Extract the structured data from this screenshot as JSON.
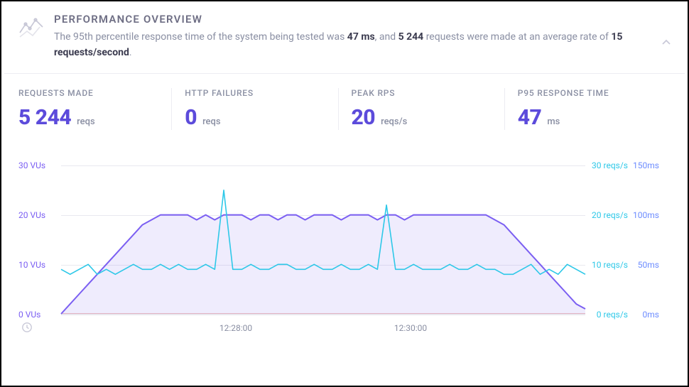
{
  "header": {
    "title": "PERFORMANCE OVERVIEW",
    "subtitle_pre": "The 95th percentile response time of the system being tested was ",
    "p95_ms": "47 ms",
    "subtitle_mid1": ", and ",
    "total_requests": "5 244",
    "subtitle_mid2": " requests were made at an average rate of ",
    "avg_rate": "15 requests/second",
    "subtitle_post": "."
  },
  "stats": [
    {
      "label": "REQUESTS MADE",
      "value": "5 244",
      "unit": "reqs"
    },
    {
      "label": "HTTP FAILURES",
      "value": "0",
      "unit": "reqs"
    },
    {
      "label": "PEAK RPS",
      "value": "20",
      "unit": "reqs/s"
    },
    {
      "label": "P95 RESPONSE TIME",
      "value": "47",
      "unit": "ms"
    }
  ],
  "chart_data": {
    "type": "line",
    "x_ticks": [
      "12:28:00",
      "12:30:00"
    ],
    "left_axis": {
      "label": "VUs",
      "ticks": [
        0,
        10,
        20,
        30
      ],
      "range": [
        0,
        30
      ],
      "color": "#7b5ff2"
    },
    "right_axis": {
      "label": "reqs/s",
      "ticks": [
        0,
        10,
        20,
        30
      ],
      "range": [
        0,
        30
      ],
      "color": "#2dc8e8"
    },
    "right_axis2": {
      "label": "ms",
      "ticks": [
        0,
        50,
        100,
        150
      ],
      "range": [
        0,
        150
      ],
      "color": "#6c8cff"
    },
    "series": [
      {
        "name": "VUs",
        "axis": "left",
        "color": "#7b5ff2",
        "fill": "rgba(123,95,242,0.12)",
        "values": [
          0,
          2,
          4,
          6,
          8,
          10,
          12,
          14,
          16,
          18,
          19,
          20,
          20,
          20,
          20,
          19,
          20,
          19,
          20,
          20,
          20,
          19,
          20,
          20,
          19,
          20,
          20,
          19,
          20,
          20,
          20,
          19,
          20,
          20,
          20,
          19,
          20,
          20,
          19,
          20,
          20,
          20,
          20,
          20,
          20,
          20,
          20,
          20,
          19,
          18,
          16,
          14,
          12,
          10,
          8,
          6,
          4,
          2,
          1
        ]
      },
      {
        "name": "reqs/s",
        "axis": "right",
        "color": "#2dc8e8",
        "values": [
          9,
          8,
          9,
          10,
          8,
          9,
          8,
          9,
          10,
          9,
          9,
          10,
          9,
          10,
          9,
          9,
          10,
          9,
          25,
          9,
          9,
          10,
          9,
          9,
          10,
          10,
          9,
          9,
          10,
          9,
          9,
          10,
          9,
          9,
          10,
          9,
          22,
          9,
          9,
          10,
          9,
          9,
          9,
          10,
          9,
          9,
          10,
          9,
          9,
          8,
          8,
          9,
          10,
          8,
          9,
          8,
          10,
          9,
          8
        ]
      }
    ],
    "response_time_ms": {
      "axis": "right2",
      "color": "#6c8cff",
      "note": "Response-time series not rendered as a distinct visible line at this scale; p95 was 47 ms."
    }
  }
}
